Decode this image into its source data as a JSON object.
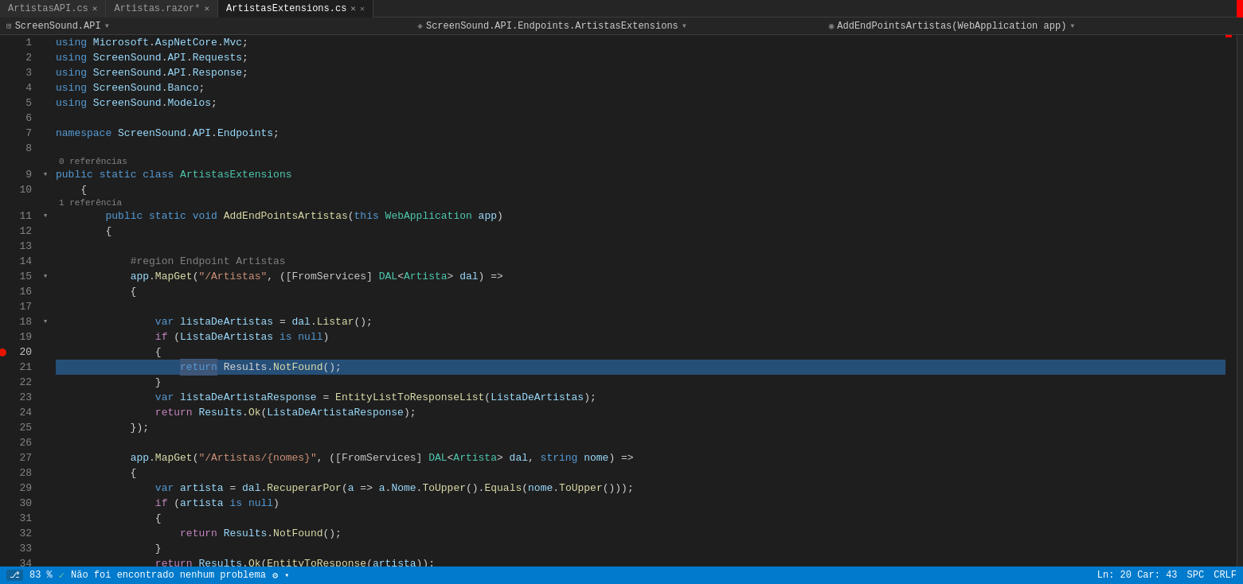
{
  "tabs": [
    {
      "label": "ArtistasAPI.cs",
      "active": false,
      "modified": false
    },
    {
      "label": "Artistas.razor",
      "active": false,
      "modified": true
    },
    {
      "label": "ArtistasExtensions.cs",
      "active": true,
      "modified": false
    }
  ],
  "breadcrumbs": {
    "left": "ScreenSound.API",
    "middle": "ScreenSound.API.Endpoints.ArtistasExtensions",
    "right": "AddEndPointsArtistas(WebApplication app)"
  },
  "status": {
    "zoom": "83 %",
    "check": "Não foi encontrado nenhum problema",
    "ln": "Ln: 20",
    "car": "Car: 43",
    "encoding": "SPC",
    "lineending": "CRLF"
  }
}
